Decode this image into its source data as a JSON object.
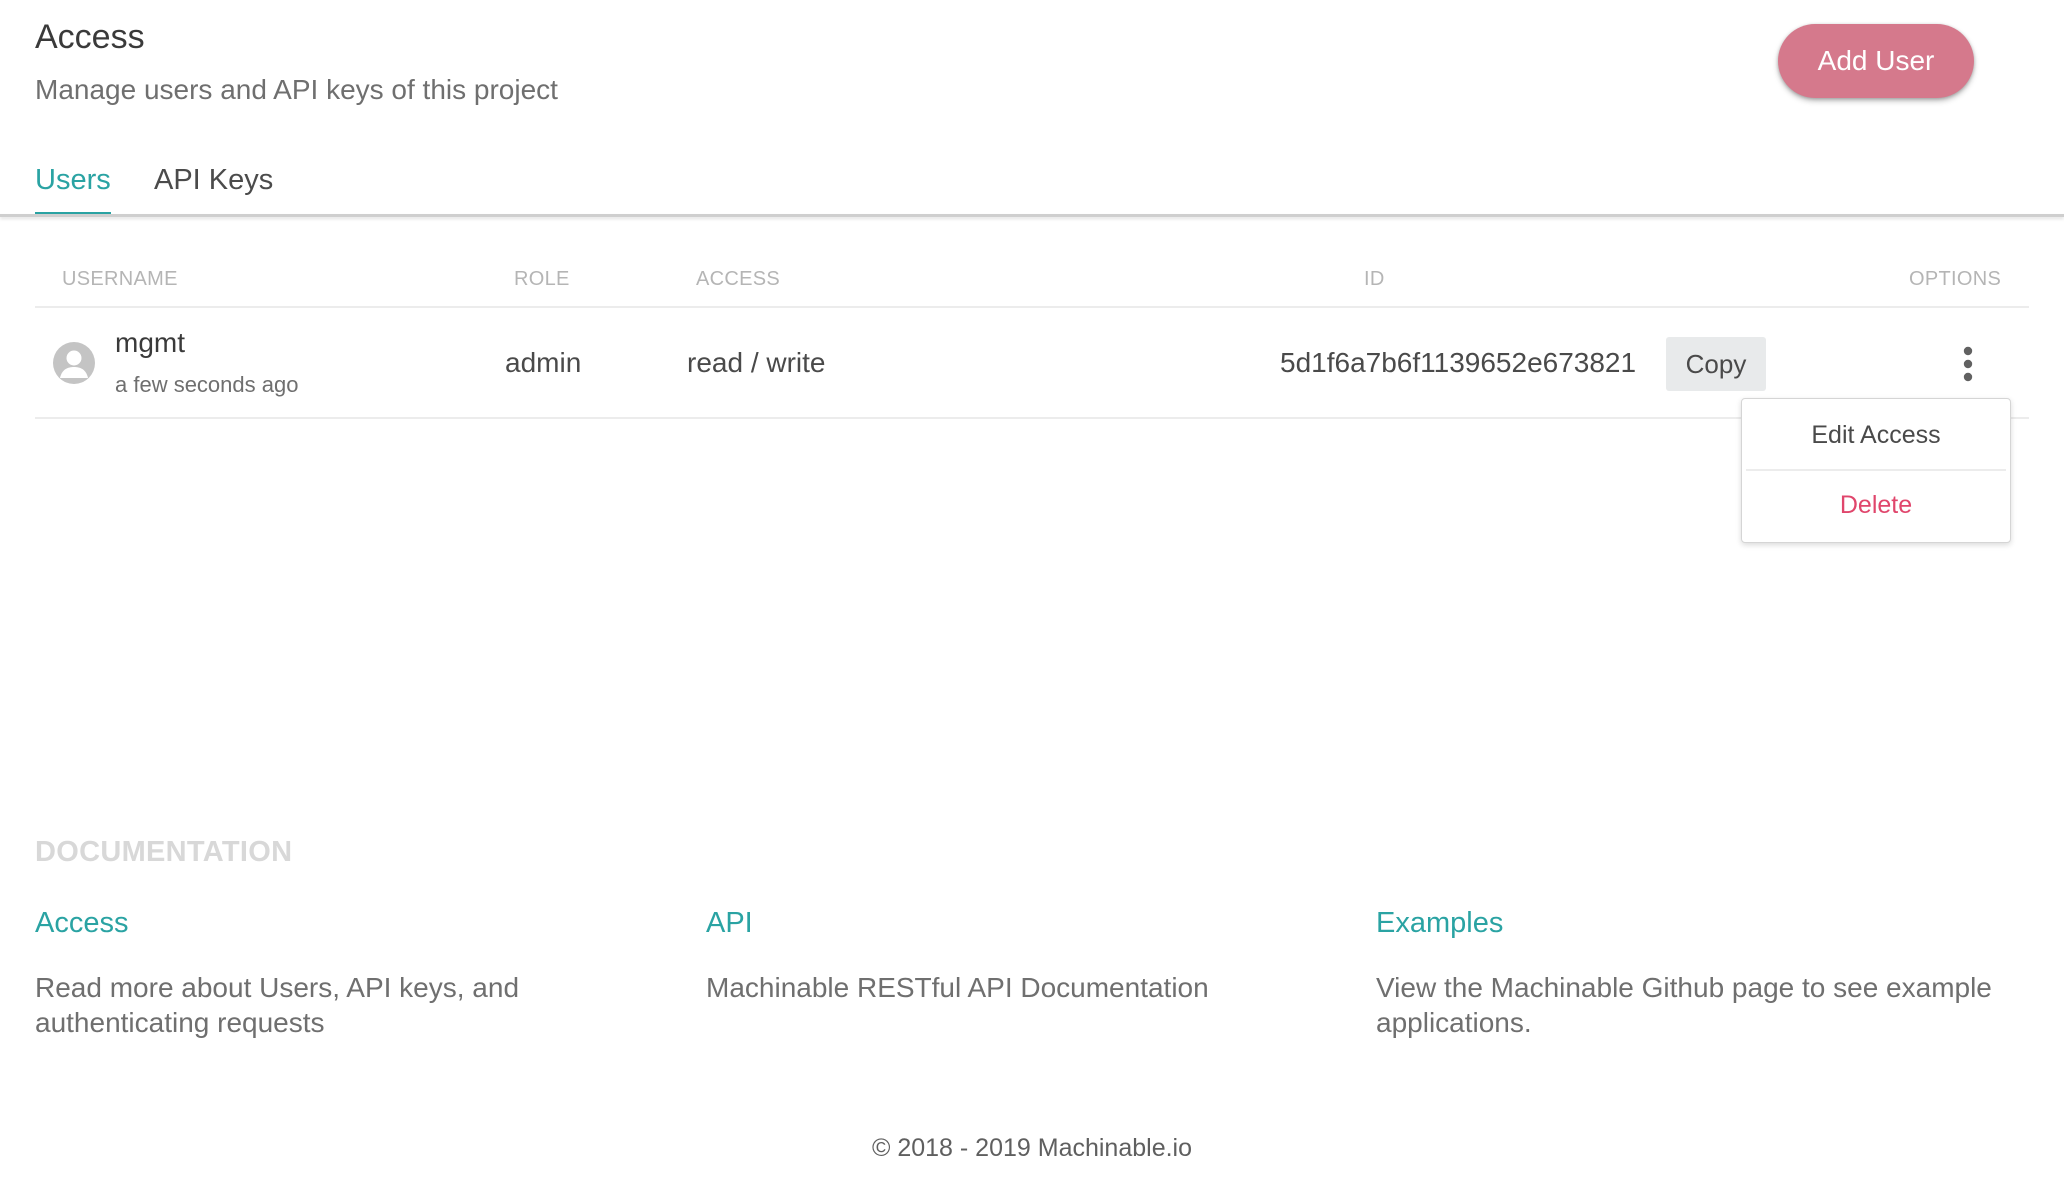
{
  "header": {
    "title": "Access",
    "subtitle": "Manage users and API keys of this project",
    "add_user_label": "Add User"
  },
  "tabs": [
    {
      "label": "Users",
      "active": true
    },
    {
      "label": "API Keys",
      "active": false
    }
  ],
  "table": {
    "columns": [
      "USERNAME",
      "ROLE",
      "ACCESS",
      "ID",
      "OPTIONS"
    ],
    "rows": [
      {
        "avatar_icon": "user-avatar-icon",
        "username": "mgmt",
        "created": "a few seconds ago",
        "role": "admin",
        "access": "read / write",
        "id": "5d1f6a7b6f1139652e673821",
        "copy_label": "Copy",
        "options_icon": "more-vertical-icon"
      }
    ]
  },
  "options_menu": {
    "items": [
      {
        "label": "Edit Access"
      },
      {
        "label": "Delete"
      }
    ]
  },
  "documentation": {
    "heading": "DOCUMENTATION",
    "links": [
      {
        "title": "Access",
        "description": "Read more about Users, API keys, and authenticating requests"
      },
      {
        "title": "API",
        "description": "Machinable RESTful API Documentation"
      },
      {
        "title": "Examples",
        "description": "View the Machinable Github page to see example applications."
      }
    ]
  },
  "footer": {
    "text": "© 2018 - 2019 Machinable.io"
  },
  "colors": {
    "accent": "#2aa3a3",
    "add_user_button": "#d5798c",
    "delete": "#e0466c"
  }
}
